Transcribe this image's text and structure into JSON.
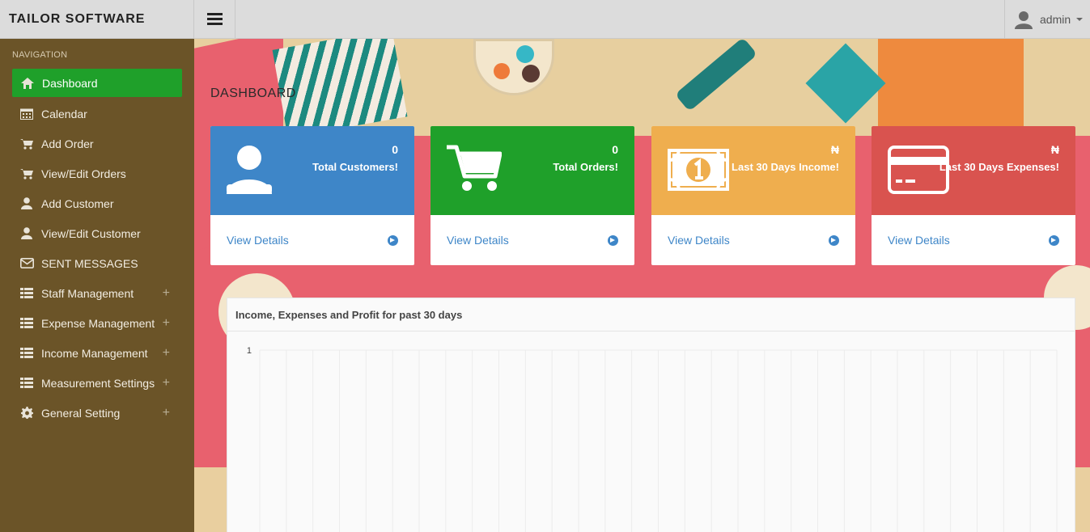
{
  "app": {
    "brand": "TAILOR SOFTWARE"
  },
  "user": {
    "name": "admin"
  },
  "nav": {
    "heading": "NAVIGATION",
    "items": [
      {
        "label": "Dashboard",
        "icon": "home-icon",
        "active": true,
        "expandable": false
      },
      {
        "label": "Calendar",
        "icon": "calendar-icon",
        "active": false,
        "expandable": false
      },
      {
        "label": "Add Order",
        "icon": "cart-icon",
        "active": false,
        "expandable": false
      },
      {
        "label": "View/Edit Orders",
        "icon": "cart-icon",
        "active": false,
        "expandable": false
      },
      {
        "label": "Add Customer",
        "icon": "user-icon",
        "active": false,
        "expandable": false
      },
      {
        "label": "View/Edit Customer",
        "icon": "user-icon",
        "active": false,
        "expandable": false
      },
      {
        "label": "SENT MESSAGES",
        "icon": "envelope-icon",
        "active": false,
        "expandable": false
      },
      {
        "label": "Staff Management",
        "icon": "list-icon",
        "active": false,
        "expandable": true
      },
      {
        "label": "Expense Management",
        "icon": "list-icon",
        "active": false,
        "expandable": true
      },
      {
        "label": "Income Management",
        "icon": "list-icon",
        "active": false,
        "expandable": true
      },
      {
        "label": "Measurement Settings",
        "icon": "list-icon",
        "active": false,
        "expandable": true
      },
      {
        "label": "General Setting",
        "icon": "gear-icon",
        "active": false,
        "expandable": true
      }
    ],
    "expand_symbol": "+"
  },
  "page": {
    "title": "DASHBOARD"
  },
  "cards": [
    {
      "value": "0",
      "label": "Total Customers!",
      "link": "View Details",
      "color": "#3e86c8",
      "icon": "user-icon"
    },
    {
      "value": "0",
      "label": "Total Orders!",
      "link": "View Details",
      "color": "#1fa02a",
      "icon": "cart-icon"
    },
    {
      "value": "₦",
      "label": "Last 30 Days Income!",
      "link": "View Details",
      "color": "#efae4e",
      "icon": "money-icon"
    },
    {
      "value": "₦",
      "label": "Last 30 Days Expenses!",
      "link": "View Details",
      "color": "#d9534f",
      "icon": "credit-card-icon"
    }
  ],
  "chart_panel": {
    "title": "Income, Expenses and Profit for past 30 days"
  },
  "chart_data": {
    "type": "line",
    "title": "Income, Expenses and Profit for past 30 days",
    "y_ticks": [
      "1"
    ],
    "grid": true,
    "series": []
  }
}
